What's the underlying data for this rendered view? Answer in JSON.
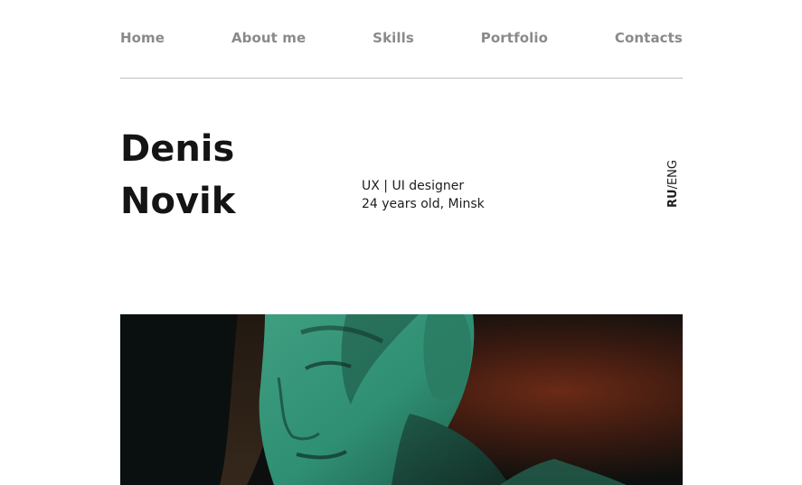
{
  "nav": {
    "items": [
      {
        "label": "Home"
      },
      {
        "label": "About me"
      },
      {
        "label": "Skills"
      },
      {
        "label": "Portfolio"
      },
      {
        "label": "Contacts"
      }
    ]
  },
  "profile": {
    "first_name": "Denis",
    "last_name": "Novik",
    "role": "UX | UI designer",
    "details": "24 years old, Minsk"
  },
  "language": {
    "ru": "RU",
    "separator": "/",
    "eng": "ENG"
  },
  "hero": {
    "alt": "Portrait photo"
  },
  "colors": {
    "nav_text": "#8a8a8a",
    "divider": "#bdbdbd",
    "heading": "#141414",
    "body_text": "#1d1d1d",
    "photo_green": "#2f8f73",
    "photo_red": "#6b2a16"
  }
}
